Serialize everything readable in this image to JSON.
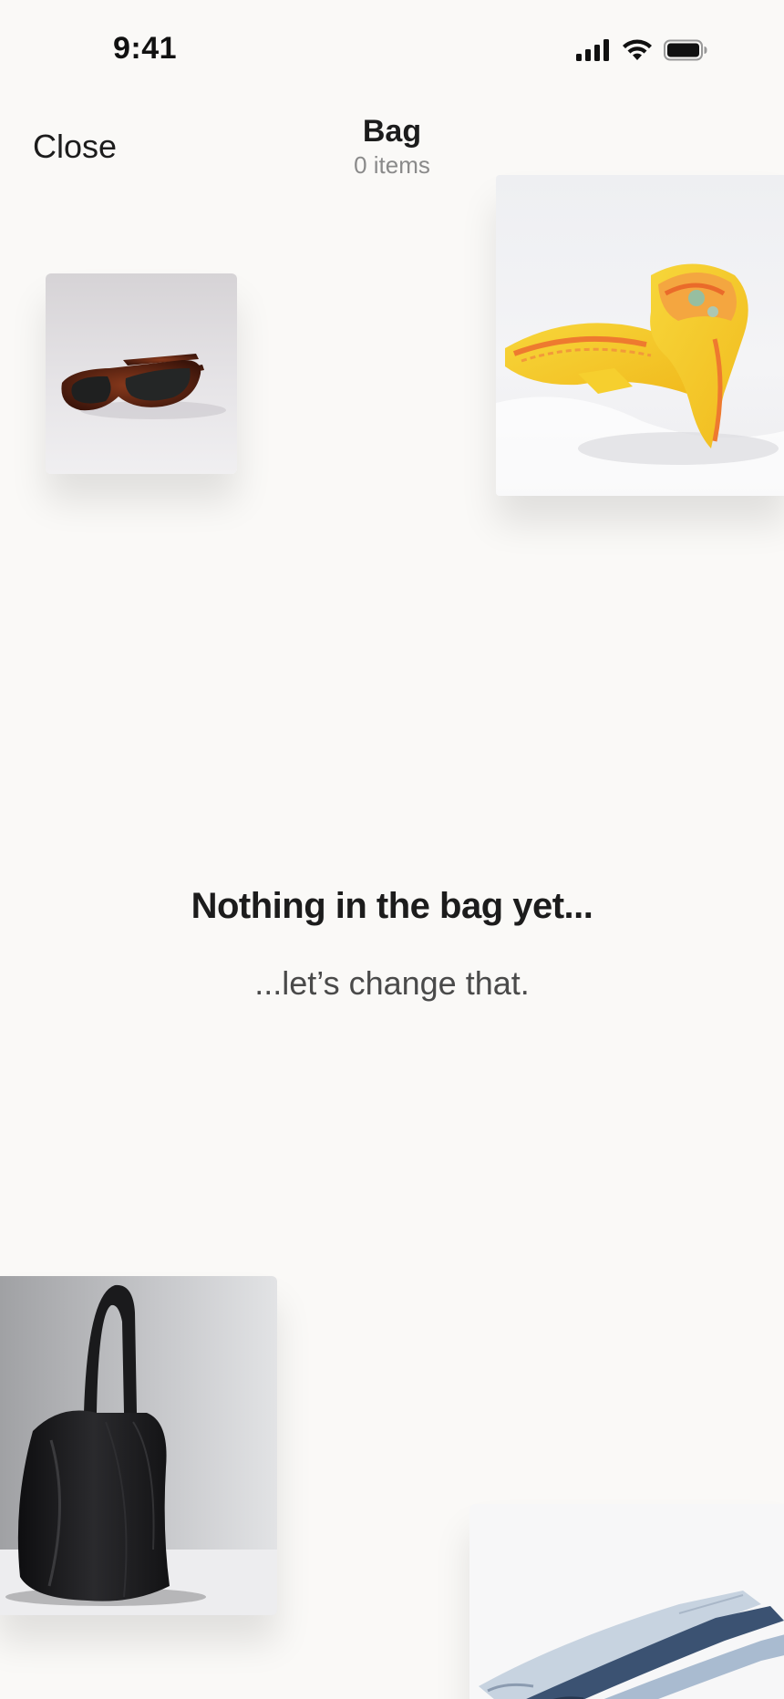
{
  "status_bar": {
    "time": "9:41",
    "icons": [
      "signal-icon",
      "wifi-icon",
      "battery-icon"
    ]
  },
  "nav": {
    "close_label": "Close",
    "title": "Bag",
    "subtitle": "0 items"
  },
  "empty_state": {
    "title": "Nothing in the bag yet...",
    "subtitle": "...let’s change that."
  },
  "decorative_products": [
    "sunglasses",
    "yellow-scarf",
    "black-leather-tote",
    "jeans"
  ],
  "colors": {
    "background": "#faf9f7",
    "text_primary": "#1c1c1c",
    "text_secondary": "#8a8a8a"
  }
}
